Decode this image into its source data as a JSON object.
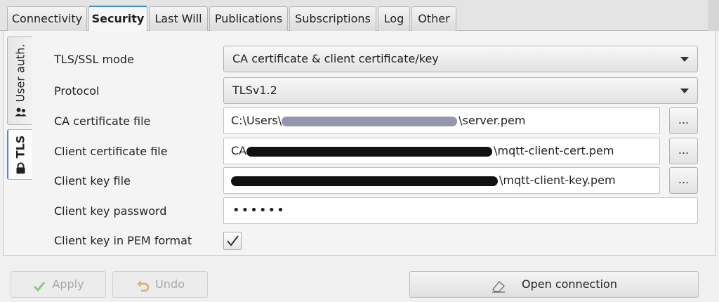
{
  "tabs": [
    "Connectivity",
    "Security",
    "Last Will",
    "Publications",
    "Subscriptions",
    "Log",
    "Other"
  ],
  "active_tab": "Security",
  "side_tabs": {
    "user_auth": "User auth.",
    "tls": "TLS"
  },
  "form": {
    "tls_mode_label": "TLS/SSL mode",
    "tls_mode_value": "CA certificate & client certificate/key",
    "protocol_label": "Protocol",
    "protocol_value": "TLSv1.2",
    "ca_file_label": "CA certificate file",
    "ca_file_prefix": "C:\\Users\\",
    "ca_file_suffix": "\\server.pem",
    "client_cert_label": "Client certificate file",
    "client_cert_prefix": "CA",
    "client_cert_suffix": "\\mqtt-client-cert.pem",
    "client_key_label": "Client key file",
    "client_key_suffix": "\\mqtt-client-key.pem",
    "key_password_label": "Client key password",
    "key_password_value": "••••••",
    "pem_label": "Client key in PEM format",
    "pem_checked": true,
    "browse_label": "..."
  },
  "buttons": {
    "apply": "Apply",
    "undo": "Undo",
    "open_connection": "Open connection"
  },
  "colors": {
    "accent": "#3a8fd8",
    "disabled_text": "#a8a8a8",
    "check_green": "#8cc88c"
  },
  "icons": {
    "apply": "checkmark-icon",
    "undo": "undo-icon",
    "open": "eraser-icon",
    "user_auth": "users-icon",
    "tls": "lock-icon"
  }
}
